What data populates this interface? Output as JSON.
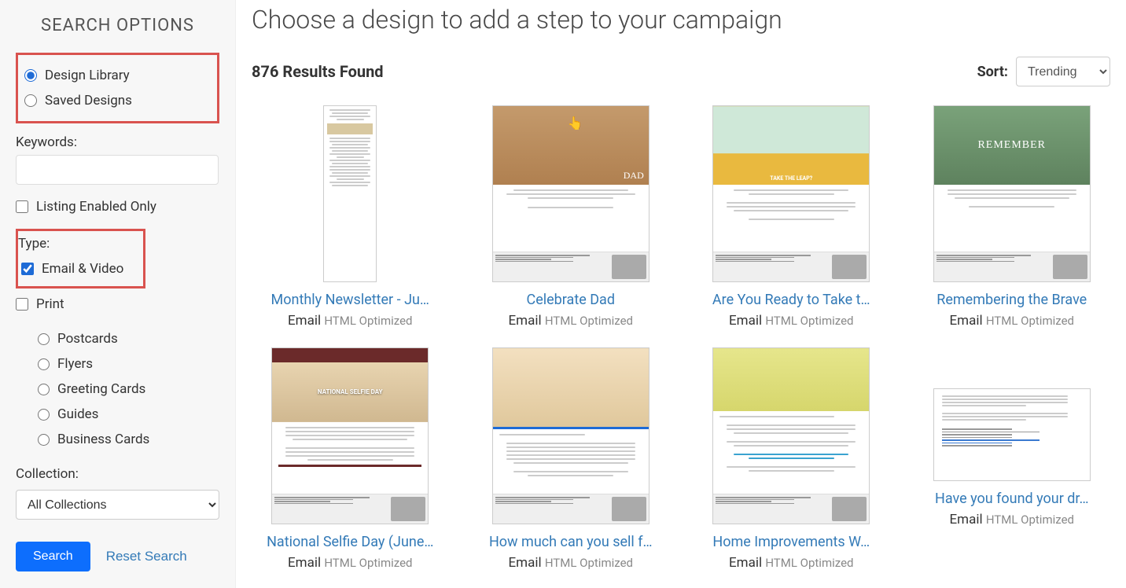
{
  "sidebar": {
    "title": "SEARCH OPTIONS",
    "source": {
      "design_library": "Design Library",
      "saved_designs": "Saved Designs"
    },
    "keywords_label": "Keywords:",
    "keywords_value": "",
    "listing_enabled": "Listing Enabled Only",
    "type_label": "Type:",
    "type_email_video": "Email & Video",
    "type_print": "Print",
    "print_sub": {
      "postcards": "Postcards",
      "flyers": "Flyers",
      "greeting_cards": "Greeting Cards",
      "guides": "Guides",
      "business_cards": "Business Cards"
    },
    "collection_label": "Collection:",
    "collection_value": "All Collections",
    "search_btn": "Search",
    "reset_btn": "Reset Search"
  },
  "main": {
    "title": "Choose a design to add a step to your campaign",
    "results_count": "876",
    "results_label": "Results Found",
    "sort_label": "Sort:",
    "sort_value": "Trending"
  },
  "cards": [
    {
      "title": "Monthly Newsletter - Ju…",
      "type": "Email",
      "sub": "HTML Optimized"
    },
    {
      "title": "Celebrate Dad",
      "type": "Email",
      "sub": "HTML Optimized"
    },
    {
      "title": "Are You Ready to Take t…",
      "type": "Email",
      "sub": "HTML Optimized"
    },
    {
      "title": "Remembering the Brave",
      "type": "Email",
      "sub": "HTML Optimized"
    },
    {
      "title": "National Selfie Day (June…",
      "type": "Email",
      "sub": "HTML Optimized"
    },
    {
      "title": "How much can you sell f…",
      "type": "Email",
      "sub": "HTML Optimized"
    },
    {
      "title": "Home Improvements W…",
      "type": "Email",
      "sub": "HTML Optimized"
    },
    {
      "title": "Have you found your dr…",
      "type": "Email",
      "sub": "HTML Optimized"
    }
  ]
}
